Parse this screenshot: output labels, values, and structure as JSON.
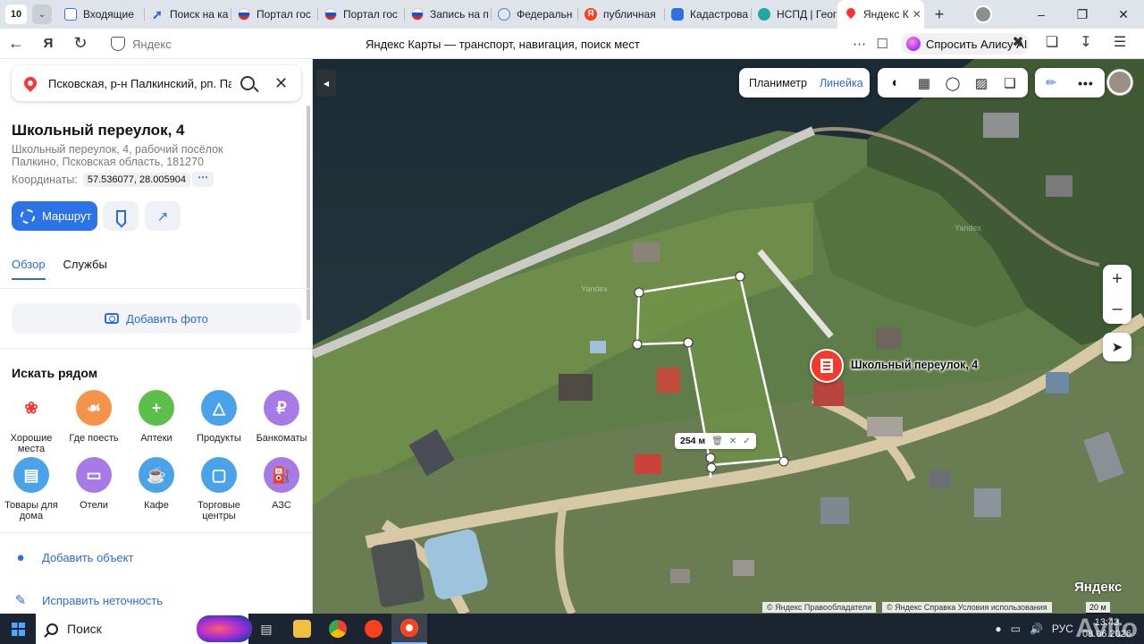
{
  "browser": {
    "tab_count": "10",
    "tabs": [
      {
        "label": "Входящие",
        "icon": "mail-icon"
      },
      {
        "label": "Поиск на ка",
        "icon": "arrow-icon"
      },
      {
        "label": "Портал гос",
        "icon": "flag-icon"
      },
      {
        "label": "Портал гос",
        "icon": "flag-icon"
      },
      {
        "label": "Запись на п",
        "icon": "flag-icon"
      },
      {
        "label": "Федеральн",
        "icon": "emblem-icon"
      },
      {
        "label": "публичная",
        "icon": "yandex-icon"
      },
      {
        "label": "Кадастрова",
        "icon": "cadastre-icon"
      },
      {
        "label": "НСПД | Геог",
        "icon": "nspd-icon"
      },
      {
        "label": "Яндекс К",
        "icon": "maps-icon",
        "active": true
      }
    ],
    "address_host": "Яндекс",
    "page_title": "Яндекс Карты — транспорт, навигация, поиск мест",
    "alice_label": "Спросить Алису AI"
  },
  "sidebar": {
    "search_value": "Псковская, р-н Палкинский, рп. Палкино, Школьный переулок, 4",
    "place_title": "Школьный переулок, 4",
    "place_address": "Школьный переулок, 4, рабочий посёлок Палкино, Псковская область, 181270",
    "coords_label": "Координаты:",
    "coords_value": "57.536077, 28.005904",
    "route_label": "Маршрут",
    "tabs": [
      "Обзор",
      "Службы"
    ],
    "add_photo_label": "Добавить фото",
    "nearby_title": "Искать рядом",
    "categories": [
      {
        "label": "Хорошие места",
        "icon": "good-places-icon",
        "color": "#ffffff"
      },
      {
        "label": "Где поесть",
        "icon": "food-icon",
        "color": "#f5934a"
      },
      {
        "label": "Аптеки",
        "icon": "pharmacy-icon",
        "color": "#5bbf4a"
      },
      {
        "label": "Продукты",
        "icon": "basket-icon",
        "color": "#4aa3e8"
      },
      {
        "label": "Банкоматы",
        "icon": "ruble-icon",
        "color": "#a67be8"
      },
      {
        "label": "Товары для дома",
        "icon": "home-goods-icon",
        "color": "#4aa3e8"
      },
      {
        "label": "Отели",
        "icon": "bed-icon",
        "color": "#a67be8"
      },
      {
        "label": "Кафе",
        "icon": "cup-icon",
        "color": "#4aa3e8"
      },
      {
        "label": "Торговые центры",
        "icon": "mall-icon",
        "color": "#4aa3e8"
      },
      {
        "label": "АЗС",
        "icon": "fuel-icon",
        "color": "#a67be8"
      }
    ],
    "actions": [
      "Добавить объект",
      "Исправить неточность"
    ]
  },
  "map": {
    "mode_planimeter": "Планиметр",
    "mode_ruler": "Линейка",
    "marker_label": "Школьный переулок, 4",
    "measure_value": "254 м",
    "watermarks": [
      "Yandex",
      "Yandex"
    ],
    "copyright_1": "© Яндекс   Правообладатели",
    "copyright_2": "© Яндекс   Справка   Условия использования",
    "scale": "20 м",
    "logo": "Яндекс"
  },
  "taskbar": {
    "search_placeholder": "Поиск",
    "lang": "РУС",
    "time": "13:43",
    "date": "08.06.2026",
    "watermark": "Avito"
  }
}
